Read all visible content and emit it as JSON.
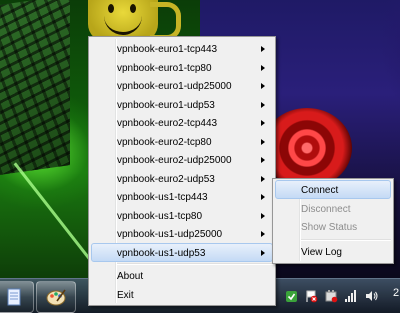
{
  "menu": {
    "servers": [
      {
        "label": "vpnbook-euro1-tcp443"
      },
      {
        "label": "vpnbook-euro1-tcp80"
      },
      {
        "label": "vpnbook-euro1-udp25000"
      },
      {
        "label": "vpnbook-euro1-udp53"
      },
      {
        "label": "vpnbook-euro2-tcp443"
      },
      {
        "label": "vpnbook-euro2-tcp80"
      },
      {
        "label": "vpnbook-euro2-udp25000"
      },
      {
        "label": "vpnbook-euro2-udp53"
      },
      {
        "label": "vpnbook-us1-tcp443"
      },
      {
        "label": "vpnbook-us1-tcp80"
      },
      {
        "label": "vpnbook-us1-udp25000"
      },
      {
        "label": "vpnbook-us1-udp53"
      }
    ],
    "highlighted_server": "vpnbook-us1-udp53",
    "about_label": "About",
    "exit_label": "Exit"
  },
  "submenu": {
    "connect_label": "Connect",
    "disconnect_label": "Disconnect",
    "show_status_label": "Show Status",
    "view_log_label": "View Log"
  },
  "taskbar": {
    "clock_fragment": "2"
  },
  "colors": {
    "menu_bg": "#f0f0f0",
    "highlight": "#c4daf5"
  }
}
